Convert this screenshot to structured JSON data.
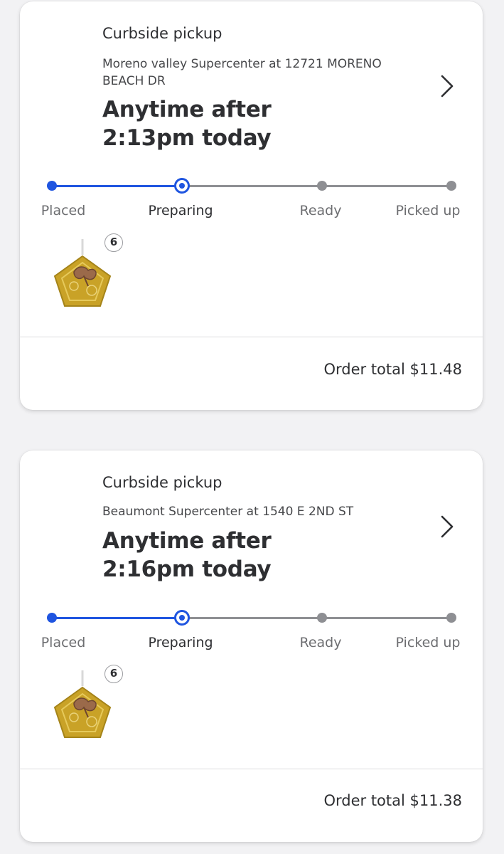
{
  "orders": [
    {
      "fulfillment": "Curbside pickup",
      "store": "Moreno valley Supercenter at 12721 MORENO BEACH DR",
      "time_line1": "Anytime after",
      "time_line2": "2:13pm today",
      "steps": [
        "Placed",
        "Preparing",
        "Ready",
        "Picked up"
      ],
      "current_step": "Preparing",
      "item_quantity": "6",
      "item_icon": "gold-pentagon-ornament",
      "order_total": "Order total $11.48"
    },
    {
      "fulfillment": "Curbside pickup",
      "store": "Beaumont Supercenter at 1540 E 2ND ST",
      "time_line1": "Anytime after",
      "time_line2": "2:16pm today",
      "steps": [
        "Placed",
        "Preparing",
        "Ready",
        "Picked up"
      ],
      "current_step": "Preparing",
      "item_quantity": "6",
      "item_icon": "gold-pentagon-ornament",
      "order_total": "Order total $11.38"
    }
  ],
  "colors": {
    "progress_active": "#1f55e0",
    "progress_inactive": "#8e8f93",
    "background": "#f2f2f4"
  }
}
